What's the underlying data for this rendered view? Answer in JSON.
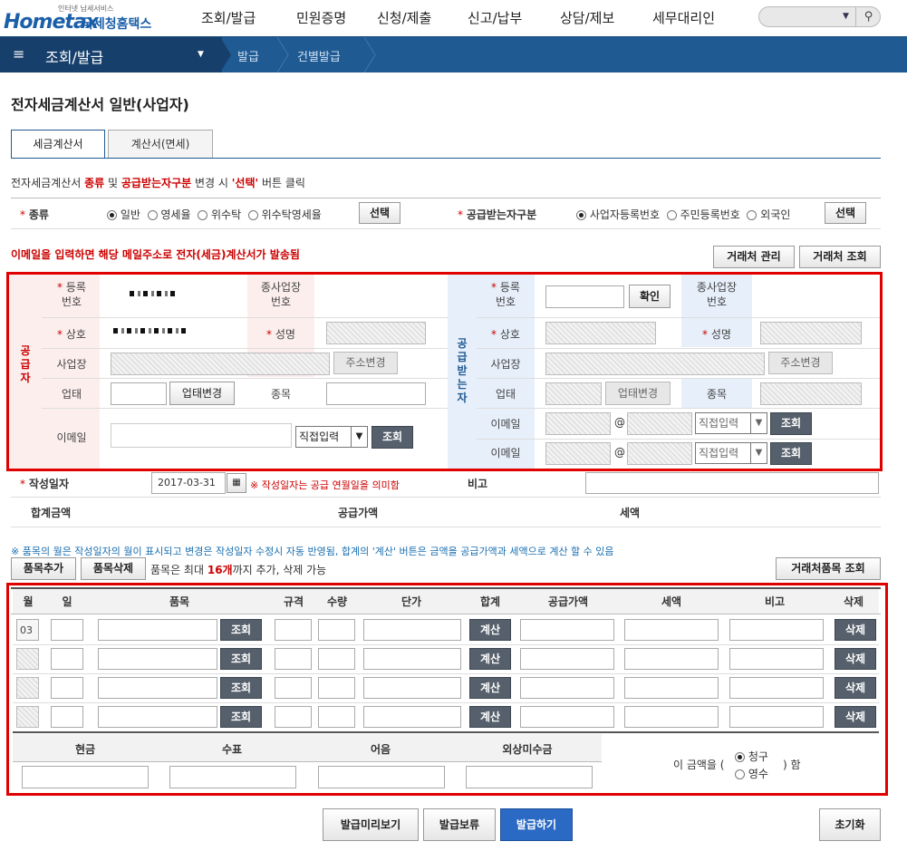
{
  "header": {
    "logo_small": "인터넷 납세서비스",
    "logo_main": "Hometax",
    "logo_kr": "국세청홈택스",
    "nav": [
      "조회/발급",
      "민원증명",
      "신청/제출",
      "신고/납부",
      "상담/제보",
      "세무대리인"
    ]
  },
  "navbar": {
    "title": "조회/발급",
    "crumbs": [
      "발급",
      "건별발급"
    ]
  },
  "page_title": "전자세금계산서 일반(사업자)",
  "tabs": [
    "세금계산서",
    "계산서(면세)"
  ],
  "guide": {
    "pre": "전자세금계산서 ",
    "kind": "종류",
    "mid": " 및 ",
    "recv": "공급받는자구분",
    "mid2": " 변경 시 ",
    "sel": "'선택'",
    "post": " 버튼 클릭"
  },
  "kind": {
    "label": "종류",
    "options": [
      "일반",
      "영세율",
      "위수탁",
      "위수탁영세율"
    ],
    "select_btn": "선택"
  },
  "recv_type": {
    "label": "공급받는자구분",
    "options": [
      "사업자등록번호",
      "주민등록번호",
      "외국인"
    ],
    "select_btn": "선택"
  },
  "email_notice": "이메일을 입력하면 해당 메일주소로 전자(세금)계산서가 발송됨",
  "partner_buttons": [
    "거래처 관리",
    "거래처 조회"
  ],
  "supplier": {
    "side": "공급자",
    "reg_no": "등록\n번호",
    "sub_biz": "종사업장\n번호",
    "name": "상호",
    "ceo": "성명",
    "addr": "사업장",
    "addr_btn": "주소변경",
    "type": "업태",
    "type_btn": "업태변경",
    "item": "종목",
    "email": "이메일",
    "email_select": "직접입력",
    "lookup": "조회"
  },
  "receiver": {
    "side": "공급받는자",
    "reg_no": "등록\n번호",
    "confirm": "확인",
    "sub_biz": "종사업장\n번호",
    "name": "상호",
    "ceo": "성명",
    "addr": "사업장",
    "addr_btn": "주소변경",
    "type": "업태",
    "type_btn": "업태변경",
    "item": "종목",
    "email": "이메일",
    "at": "@",
    "email_select": "직접입력",
    "lookup": "조회"
  },
  "write_date": {
    "label": "작성일자",
    "value": "2017-03-31",
    "note": "※ 작성일자는 공급 연월일을 의미함"
  },
  "remark_label": "비고",
  "totals": {
    "total": "합계금액",
    "supply": "공급가액",
    "tax": "세액"
  },
  "item_notice": "※ 품목의 월은 작성일자의 월이 표시되고 변경은 작성일자 수정시 자동 반영됨, 합계의 '계산' 버튼은 금액을 공급가액과 세액으로 계산 할 수 있음",
  "item_buttons": {
    "add": "품목추가",
    "del": "품목삭제",
    "limit_pre": "품목은 최대 ",
    "limit_n": "16개",
    "limit_post": "까지 추가, 삭제 가능",
    "partner_items": "거래처품목 조회"
  },
  "item_table": {
    "headers": [
      "월",
      "일",
      "품목",
      "규격",
      "수량",
      "단가",
      "합계",
      "공급가액",
      "세액",
      "비고",
      "삭제"
    ],
    "first_month": "03",
    "lookup": "조회",
    "calc": "계산",
    "delete": "삭제"
  },
  "payment": {
    "headers": [
      "현금",
      "수표",
      "어음",
      "외상미수금"
    ],
    "pre": "이 금액을 (",
    "opt1": "청구",
    "opt2": "영수",
    "post": ") 함"
  },
  "bottom_buttons": [
    "발급미리보기",
    "발급보류",
    "발급하기",
    "초기화"
  ]
}
